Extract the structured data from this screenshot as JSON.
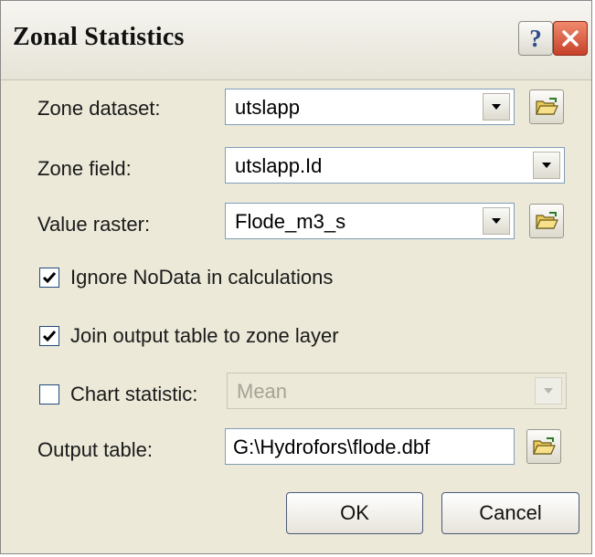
{
  "dialog": {
    "title": "Zonal Statistics",
    "help_label": "?"
  },
  "fields": {
    "zone_dataset_label": "Zone dataset:",
    "zone_dataset_value": "utslapp",
    "zone_field_label": "Zone field:",
    "zone_field_value": "utslapp.Id",
    "value_raster_label": "Value raster:",
    "value_raster_value": "Flode_m3_s",
    "chart_statistic_label": "Chart statistic:",
    "chart_statistic_value": "Mean",
    "output_table_label": "Output table:",
    "output_table_value": "G:\\Hydrofors\\flode.dbf"
  },
  "checkboxes": {
    "ignore_nodata": {
      "label": "Ignore NoData in calculations",
      "checked": true
    },
    "join_output": {
      "label": "Join output table to zone layer",
      "checked": true
    },
    "chart_statistic": {
      "checked": false
    }
  },
  "buttons": {
    "ok": "OK",
    "cancel": "Cancel"
  },
  "icons": {
    "close": "close-icon",
    "folder": "open-folder-icon",
    "dropdown": "chevron-down-icon",
    "check": "check-icon"
  },
  "colors": {
    "dialog_bg": "#ece9d8",
    "close_button": "#c7412a",
    "input_border": "#7f9db9"
  }
}
